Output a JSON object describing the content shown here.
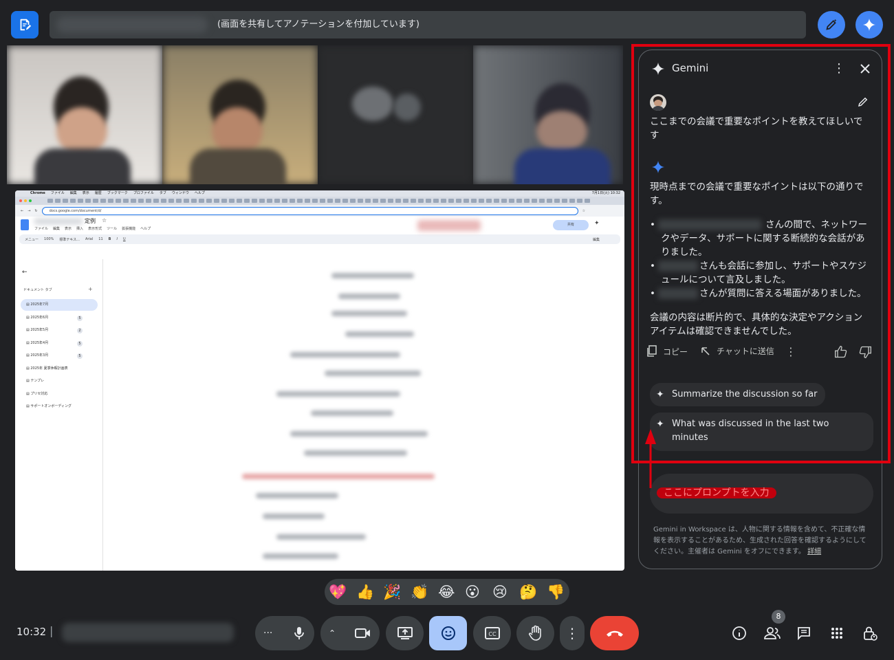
{
  "top": {
    "banner_text": "(画面を共有してアノテーションを付加しています)"
  },
  "screen": {
    "mac_menu": [
      "Chrome",
      "ファイル",
      "編集",
      "表示",
      "履歴",
      "ブックマーク",
      "プロファイル",
      "タブ",
      "ウィンドウ",
      "ヘルプ"
    ],
    "clock": "7月1日(火) 10:32",
    "url": "docs.google.com/document/d/",
    "doc_title": "定例",
    "doc_menu": [
      "ファイル",
      "編集",
      "表示",
      "挿入",
      "表示形式",
      "ツール",
      "拡張機能",
      "ヘルプ"
    ],
    "share_label": "共有",
    "toolbar": {
      "menu": "メニュー",
      "zoom": "100%",
      "style": "標準テキス...",
      "font": "Arial",
      "size": "11",
      "edit_mode": "編集"
    },
    "tabs_heading": "ドキュメント タブ",
    "tabs": [
      {
        "label": "2025年7月",
        "badge": ""
      },
      {
        "label": "2025年6月",
        "badge": "5"
      },
      {
        "label": "2025年5月",
        "badge": "2"
      },
      {
        "label": "2025年4月",
        "badge": "5"
      },
      {
        "label": "2025年3月",
        "badge": "5"
      },
      {
        "label": "2025年 夏季休暇計画表",
        "badge": ""
      },
      {
        "label": "テンプレ",
        "badge": ""
      },
      {
        "label": "プリセ対応",
        "badge": ""
      },
      {
        "label": "サポートオンボーディング",
        "badge": ""
      }
    ]
  },
  "gemini": {
    "title": "Gemini",
    "user_prompt": "ここまでの会議で重要なポイントを教えてほしいです",
    "response_intro": "現時点までの会議で重要なポイントは以下の通りです。",
    "bullets": [
      "さんの間で、ネットワークやデータ、サポートに関する断続的な会話がありました。",
      "さんも会話に参加し、サポートやスケジュールについて言及しました。",
      "さんが質問に答える場面がありました。"
    ],
    "response_outro": "会議の内容は断片的で、具体的な決定やアクションアイテムは確認できませんでした。",
    "copy_label": "コピー",
    "send_to_chat_label": "チャットに送信",
    "suggestions": [
      "Summarize the discussion so far",
      "What was discussed in the last two minutes"
    ],
    "input_placeholder": "ここにプロンプトを入力",
    "disclaimer": "Gemini in Workspace は、人物に関する情報を含めて、不正確な情報を表示することがあるため、生成された回答を確認するようにしてください。主催者は Gemini をオフにできます。",
    "details_link": "詳細"
  },
  "reactions": [
    "💖",
    "👍",
    "🎉",
    "👏",
    "😂",
    "😮",
    "😢",
    "🤔",
    "👎"
  ],
  "bottom": {
    "time": "10:32",
    "separator": "|",
    "people_count": "8"
  },
  "colors": {
    "background": "#202124",
    "accent": "#4285f4",
    "highlight": "#e0000f",
    "end_call": "#ea4335",
    "reaction_active": "#a8c7fa"
  }
}
